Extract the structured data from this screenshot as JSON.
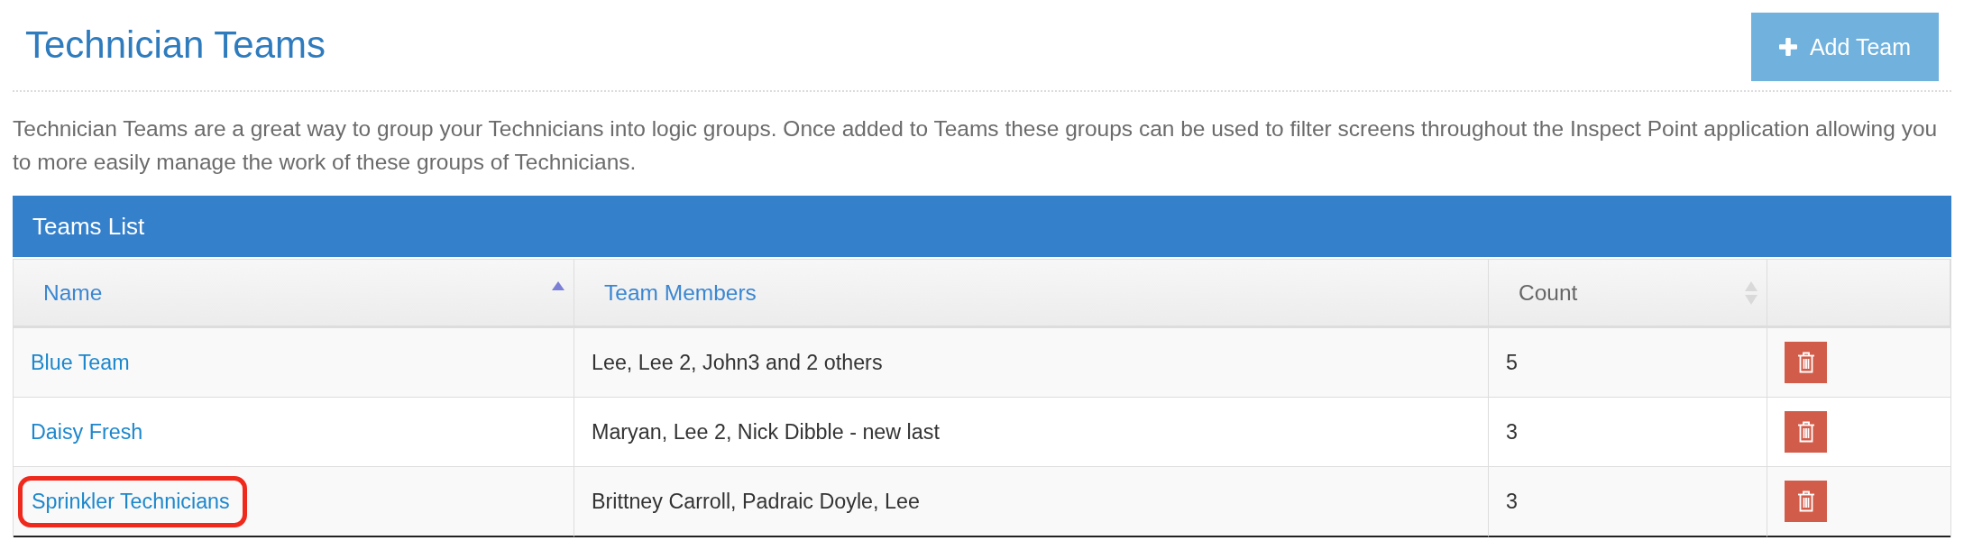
{
  "page": {
    "title": "Technician Teams",
    "add_button": {
      "label": "Add Team"
    },
    "description": "Technician Teams are a great way to group your Technicians into logic groups. Once added to Teams these groups can be used to filter screens throughout the Inspect Point application allowing you to more easily manage the work of these groups of Technicians."
  },
  "panel": {
    "title": "Teams List"
  },
  "table": {
    "columns": [
      {
        "label": "Name",
        "kind": "link",
        "sortable": true,
        "sorted": true
      },
      {
        "label": "Team Members",
        "kind": "link",
        "sortable": false,
        "sorted": false
      },
      {
        "label": "Count",
        "kind": "plain",
        "sortable": true,
        "sorted": false
      }
    ],
    "rows": [
      {
        "name": "Blue Team",
        "members": "Lee, Lee 2, John3 and 2 others",
        "count": "5",
        "highlighted": false
      },
      {
        "name": "Daisy Fresh",
        "members": "Maryan, Lee 2, Nick Dibble - new last",
        "count": "3",
        "highlighted": false
      },
      {
        "name": "Sprinkler Technicians",
        "members": "Brittney Carroll, Padraic Doyle, Lee",
        "count": "3",
        "highlighted": true
      }
    ]
  }
}
